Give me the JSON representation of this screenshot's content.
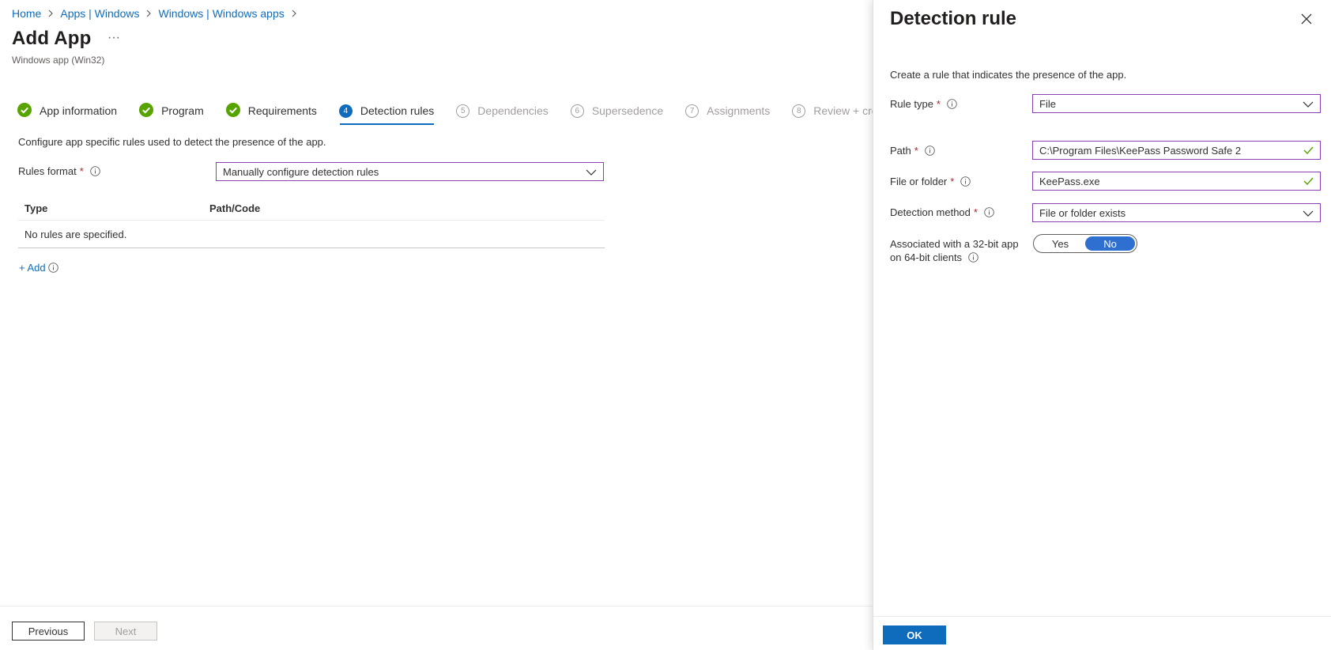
{
  "breadcrumb": [
    "Home",
    "Apps | Windows",
    "Windows | Windows apps"
  ],
  "page": {
    "title": "Add App",
    "subtitle": "Windows app (Win32)",
    "more_label": "···"
  },
  "tabs": [
    {
      "label": "App information",
      "state": "done"
    },
    {
      "label": "Program",
      "state": "done"
    },
    {
      "label": "Requirements",
      "state": "done"
    },
    {
      "number": "4",
      "label": "Detection rules",
      "state": "active"
    },
    {
      "number": "5",
      "label": "Dependencies",
      "state": "pending"
    },
    {
      "number": "6",
      "label": "Supersedence",
      "state": "pending"
    },
    {
      "number": "7",
      "label": "Assignments",
      "state": "pending"
    },
    {
      "number": "8",
      "label": "Review + create",
      "state": "pending"
    }
  ],
  "main": {
    "description": "Configure app specific rules used to detect the presence of the app.",
    "rules_format_label": "Rules format",
    "rules_format_value": "Manually configure detection rules",
    "table": {
      "headers": [
        "Type",
        "Path/Code"
      ],
      "empty_text": "No rules are specified."
    },
    "add_label": "+ Add"
  },
  "footer": {
    "previous_label": "Previous",
    "next_label": "Next"
  },
  "panel": {
    "title": "Detection rule",
    "description": "Create a rule that indicates the presence of the app.",
    "rule_type_label": "Rule type",
    "rule_type_value": "File",
    "path_label": "Path",
    "path_value": "C:\\Program Files\\KeePass Password Safe 2",
    "file_label": "File or folder",
    "file_value": "KeePass.exe",
    "method_label": "Detection method",
    "method_value": "File or folder exists",
    "assoc_label_line1": "Associated with a 32-bit app",
    "assoc_label_line2": "on 64-bit clients",
    "toggle_yes": "Yes",
    "toggle_no": "No",
    "toggle_selected": "No",
    "ok_label": "OK"
  },
  "colors": {
    "accent": "#0f6cbd",
    "success": "#57a300",
    "required": "#a4262c",
    "input_border": "#8a3fb4"
  }
}
